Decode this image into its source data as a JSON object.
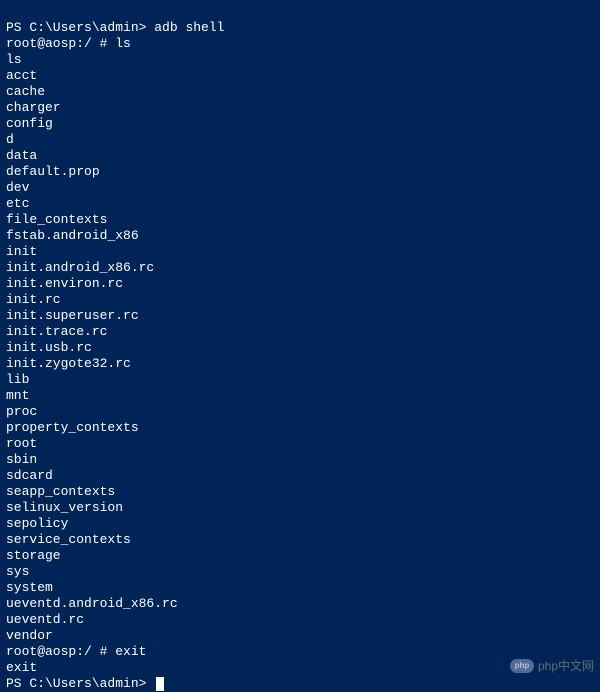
{
  "prompts": {
    "ps_path": "PS C:\\Users\\admin> ",
    "root_prompt": "root@aosp:/ # "
  },
  "commands": {
    "adb_shell": "adb shell",
    "ls": "ls",
    "exit": "exit"
  },
  "echo": {
    "ls": "ls",
    "exit": "exit"
  },
  "listing": [
    "acct",
    "cache",
    "charger",
    "config",
    "d",
    "data",
    "default.prop",
    "dev",
    "etc",
    "file_contexts",
    "fstab.android_x86",
    "init",
    "init.android_x86.rc",
    "init.environ.rc",
    "init.rc",
    "init.superuser.rc",
    "init.trace.rc",
    "init.usb.rc",
    "init.zygote32.rc",
    "lib",
    "mnt",
    "proc",
    "property_contexts",
    "root",
    "sbin",
    "sdcard",
    "seapp_contexts",
    "selinux_version",
    "sepolicy",
    "service_contexts",
    "storage",
    "sys",
    "system",
    "ueventd.android_x86.rc",
    "ueventd.rc",
    "vendor"
  ],
  "watermark": {
    "logo_text": "php",
    "label": "php中文网"
  }
}
